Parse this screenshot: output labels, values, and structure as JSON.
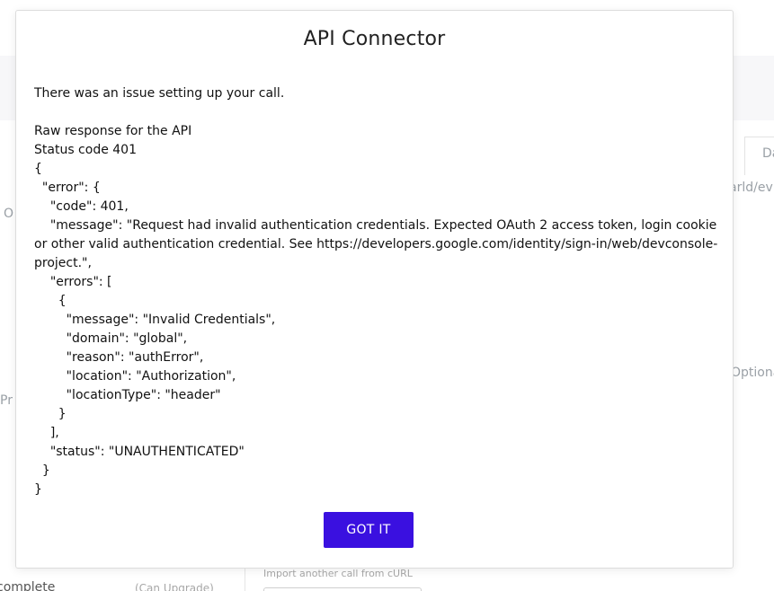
{
  "background": {
    "right_text_1": "Da",
    "right_text_2": "arld/ev",
    "left_text_1": "O",
    "right_text_3": "Optiona",
    "left_text_2": "Pr",
    "footer_left": "complete",
    "footer_mid": "(Can Upgrade)",
    "footer_import": "Import another call from cURL"
  },
  "modal": {
    "title": "API Connector",
    "intro": "There was an issue setting up your call.",
    "raw_label": "Raw response for the API",
    "status_line": "Status code 401",
    "response_body": "{\n  \"error\": {\n    \"code\": 401,\n    \"message\": \"Request had invalid authentication credentials. Expected OAuth 2 access token, login cookie or other valid authentication credential. See https://developers.google.com/identity/sign-in/web/devconsole-project.\",\n    \"errors\": [\n      {\n        \"message\": \"Invalid Credentials\",\n        \"domain\": \"global\",\n        \"reason\": \"authError\",\n        \"location\": \"Authorization\",\n        \"locationType\": \"header\"\n      }\n    ],\n    \"status\": \"UNAUTHENTICATED\"\n  }\n}",
    "button_label": "GOT IT"
  },
  "colors": {
    "accent": "#3a10e0",
    "text": "#111111",
    "background_text": "#9aa0a6"
  }
}
